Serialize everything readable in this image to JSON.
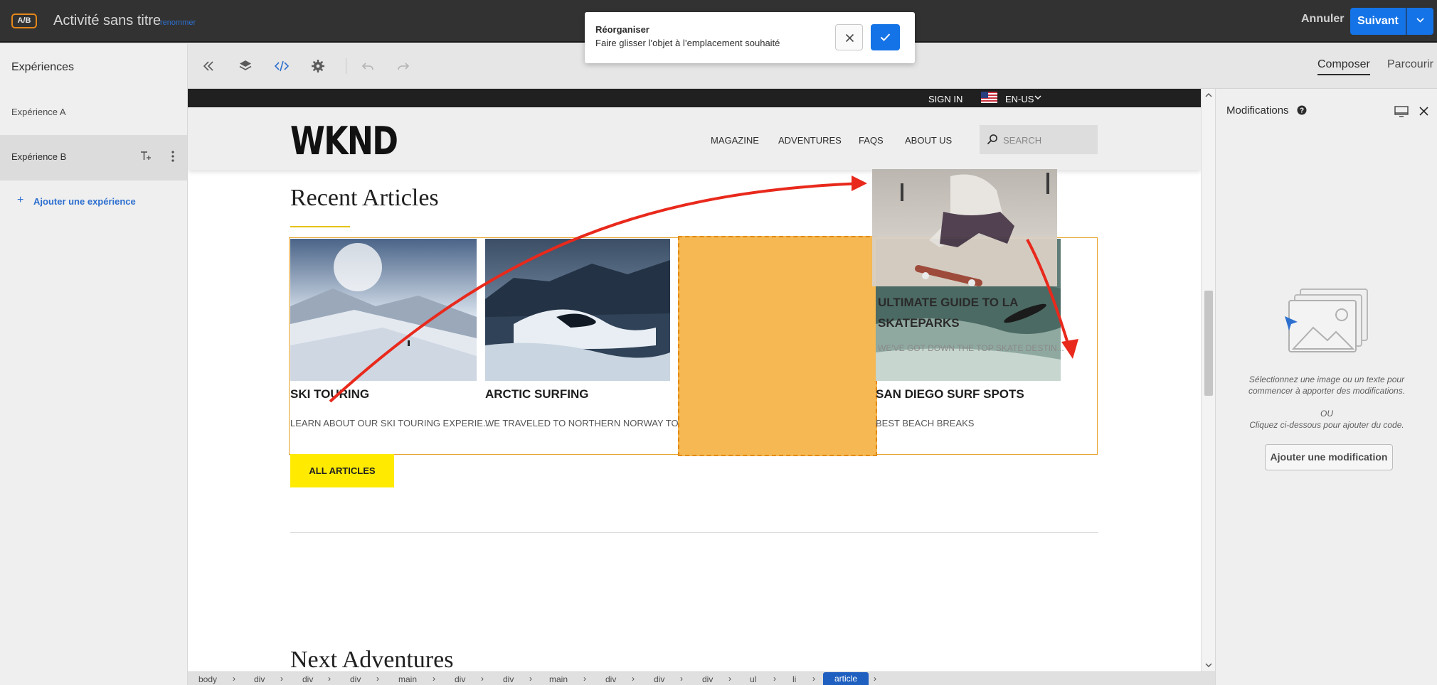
{
  "topbar": {
    "badge": "A/B",
    "activity_title": "Activité sans titre",
    "rename_link": "renommer",
    "cancel_label": "Annuler",
    "next_label": "Suivant"
  },
  "toast": {
    "title": "Réorganiser",
    "message": "Faire glisser l’objet à l’emplacement souhaité"
  },
  "left_panel": {
    "title": "Expériences",
    "items": [
      {
        "label": "Expérience A"
      },
      {
        "label": "Expérience B"
      }
    ],
    "add_label": "Ajouter une expérience"
  },
  "toolbar": {
    "tabs": [
      {
        "label": "Composer"
      },
      {
        "label": "Parcourir"
      }
    ]
  },
  "site": {
    "sign_in": "SIGN IN",
    "locale": "EN-US",
    "logo": "WKND",
    "nav": [
      {
        "label": "MAGAZINE"
      },
      {
        "label": "ADVENTURES"
      },
      {
        "label": "FAQS"
      },
      {
        "label": "ABOUT US"
      }
    ],
    "search_placeholder": "SEARCH",
    "recent_title": "Recent Articles",
    "cards": [
      {
        "title": "SKI TOURING",
        "desc": "LEARN ABOUT OUR SKI TOURING EXPERIE..."
      },
      {
        "title": "ARCTIC SURFING",
        "desc": "WE TRAVELED TO NORTHERN NORWAY TO..."
      },
      {
        "title": "SAN DIEGO SURF SPOTS",
        "desc": "BEST BEACH BREAKS"
      }
    ],
    "dragged_card": {
      "title": "ULTIMATE GUIDE TO LA SKATEPARKS",
      "desc": "WE'VE GOT DOWN THE TOP SKATE DESTIN..."
    },
    "all_articles": "ALL ARTICLES",
    "next_title": "Next Adventures"
  },
  "right_panel": {
    "title": "Modifications",
    "hint_line1": "Sélectionnez une image ou un texte pour commencer à apporter des modifications.",
    "hint_or": "OU",
    "hint_line2": "Cliquez ci-dessous pour ajouter du code.",
    "add_button": "Ajouter une modification"
  },
  "breadcrumb": [
    "body",
    "div",
    "div",
    "div",
    "main",
    "div",
    "div",
    "main",
    "div",
    "div",
    "div",
    "ul",
    "li",
    "article"
  ],
  "colors": {
    "accent_blue": "#1473e6",
    "drop_slot": "#f5b852",
    "brand_yellow": "#ffea00",
    "annotation_red": "#e8291c"
  }
}
